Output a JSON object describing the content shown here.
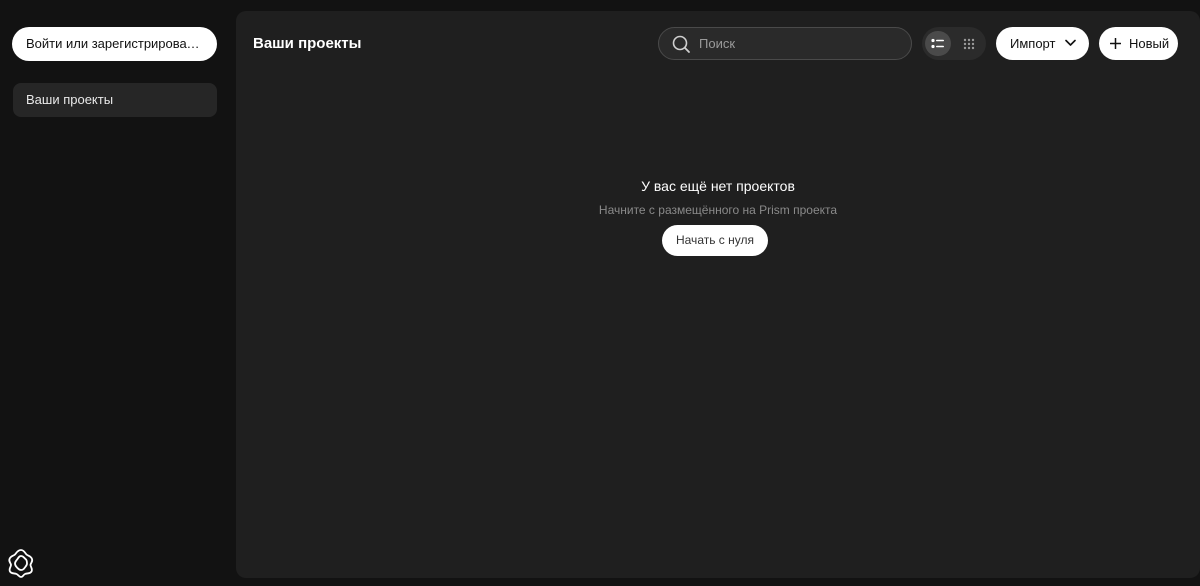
{
  "sidebar": {
    "login_label": "Войти или зарегистрироваться",
    "nav_items": [
      {
        "label": "Ваши проекты",
        "selected": true
      }
    ],
    "settings_icon": "flower-settings-icon"
  },
  "header": {
    "title": "Ваши проекты",
    "search": {
      "placeholder": "Поиск",
      "value": ""
    },
    "view_modes": [
      "list-view-icon",
      "grid-view-icon"
    ],
    "active_view": "list",
    "import_label": "Импорт",
    "new_label": "Новый"
  },
  "empty_state": {
    "title": "У вас ещё нет проектов",
    "subtitle": "Начните с размещённого на Prism проекта",
    "start_label": "Начать с нуля"
  },
  "colors": {
    "background": "#121212",
    "panel": "#1f1f1f",
    "nav_selected": "#262626",
    "button_light": "#ffffff"
  }
}
